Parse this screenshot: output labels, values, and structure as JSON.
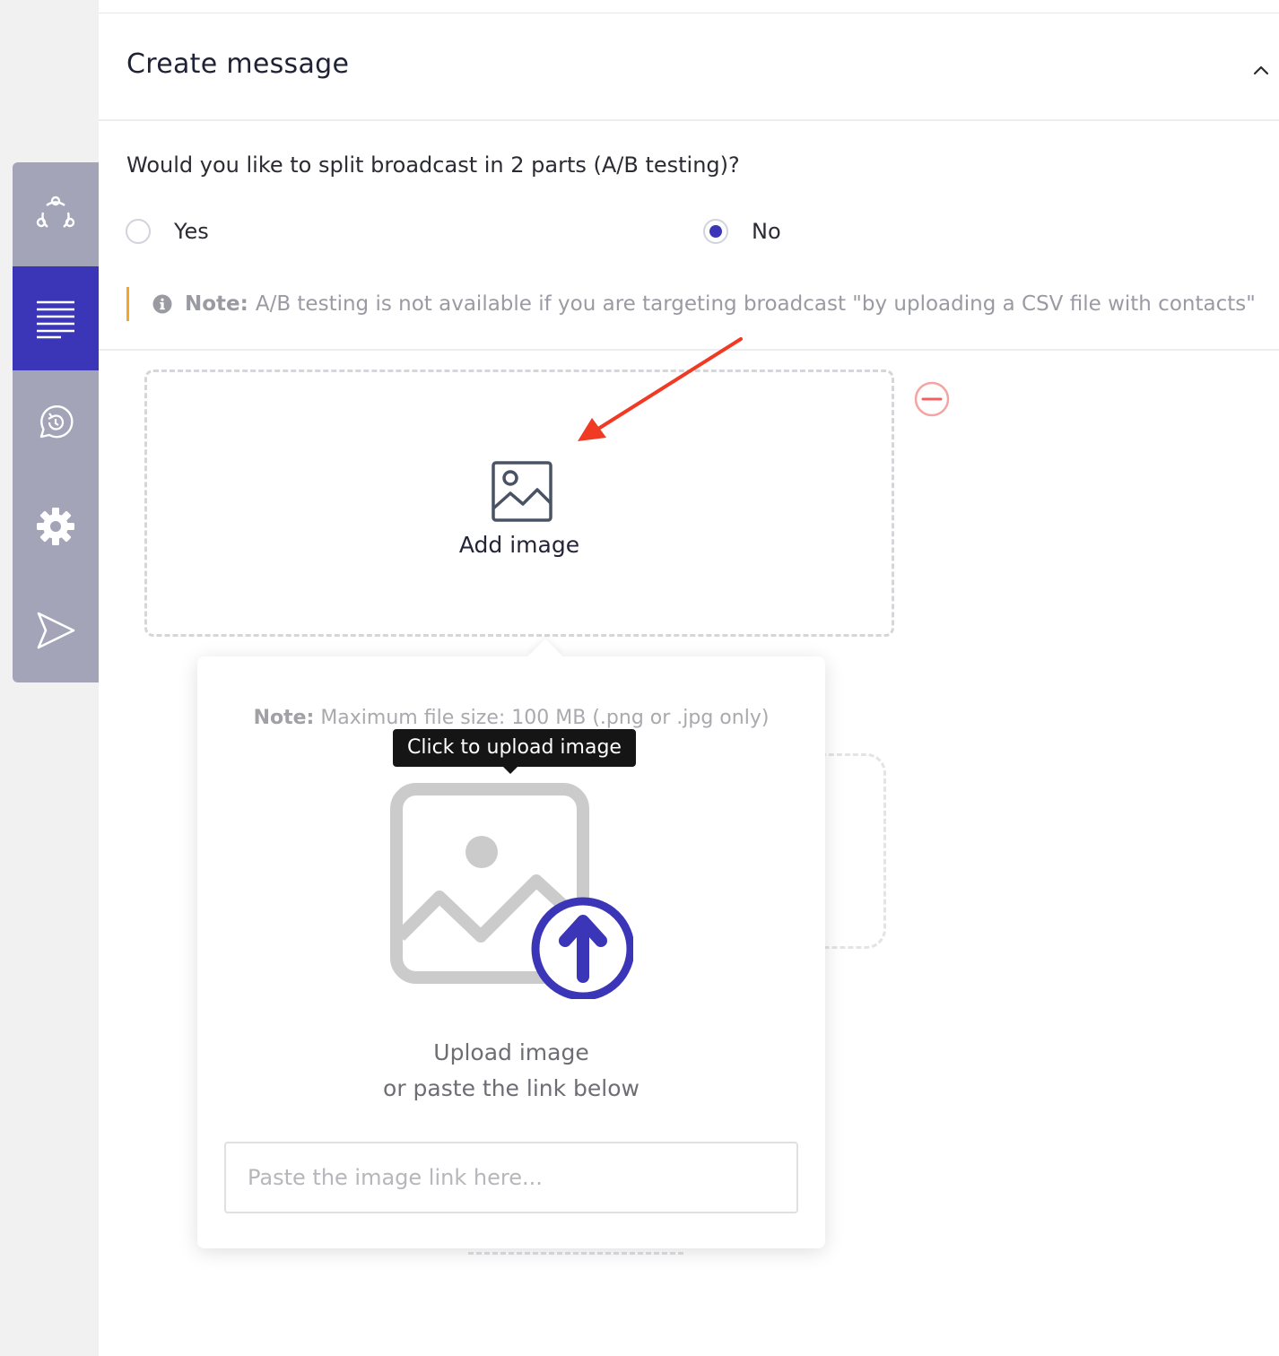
{
  "section": {
    "title": "Create message"
  },
  "ab_test": {
    "question": "Would you like to split broadcast in 2 parts (A/B testing)?",
    "options": [
      {
        "label": "Yes",
        "selected": false
      },
      {
        "label": "No",
        "selected": true
      }
    ],
    "note_label": "Note:",
    "note_text": "A/B testing is not available if you are targeting broadcast \"by uploading a CSV file with contacts\""
  },
  "dropzone": {
    "add_label": "Add image",
    "icon": "image-icon"
  },
  "sidebar": {
    "items": [
      {
        "icon": "audience-icon",
        "active": false
      },
      {
        "icon": "message-lines-icon",
        "active": true
      },
      {
        "icon": "whatsapp-icon",
        "active": false
      },
      {
        "icon": "gear-icon",
        "active": false
      },
      {
        "icon": "send-icon",
        "active": false
      }
    ]
  },
  "popover": {
    "note_label": "Note:",
    "note_text": "Maximum file size: 100 MB (.png or .jpg only)",
    "tooltip": "Click to upload image",
    "upload_line1": "Upload image",
    "upload_line2": "or paste the link below",
    "link_placeholder": "Paste the image link here..."
  },
  "colors": {
    "accent": "#3b35b8",
    "sidebar": "#a3a4b8",
    "note_bar": "#f5a623",
    "remove": "#f06060",
    "annotation_arrow": "#f03a24"
  }
}
